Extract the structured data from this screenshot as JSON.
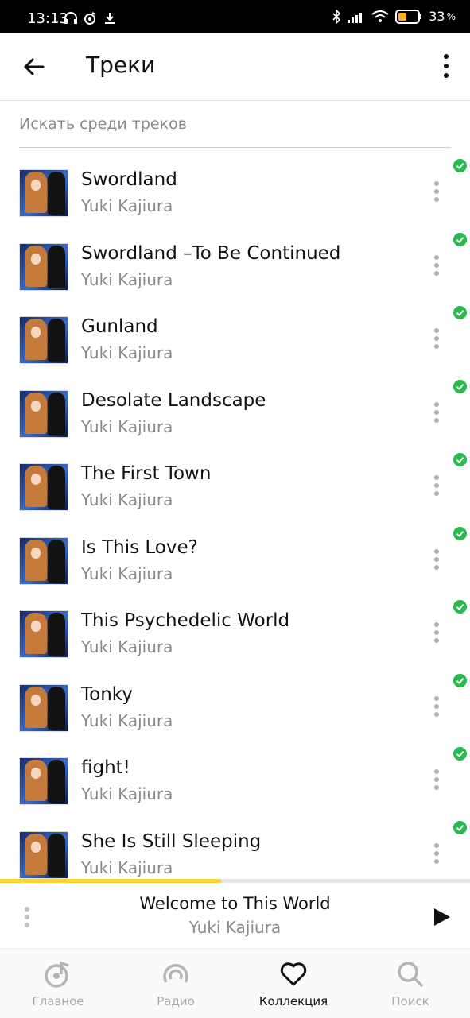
{
  "status": {
    "time": "13:13",
    "battery": "33"
  },
  "header": {
    "title": "Треки"
  },
  "search": {
    "placeholder": "Искать среди треков"
  },
  "tracks": [
    {
      "title": "Swordland",
      "artist": "Yuki Kajiura"
    },
    {
      "title": "Swordland –To Be Continued",
      "artist": "Yuki Kajiura"
    },
    {
      "title": "Gunland",
      "artist": "Yuki Kajiura"
    },
    {
      "title": "Desolate Landscape",
      "artist": "Yuki Kajiura"
    },
    {
      "title": "The First Town",
      "artist": "Yuki Kajiura"
    },
    {
      "title": "Is This Love?",
      "artist": "Yuki Kajiura"
    },
    {
      "title": "This Psychedelic World",
      "artist": "Yuki Kajiura"
    },
    {
      "title": "Tonky",
      "artist": "Yuki Kajiura"
    },
    {
      "title": "fight!",
      "artist": "Yuki Kajiura"
    },
    {
      "title": "She Is Still Sleeping",
      "artist": "Yuki Kajiura"
    }
  ],
  "player": {
    "title": "Welcome to This World",
    "artist": "Yuki Kajiura",
    "progress": 0.47
  },
  "nav": [
    {
      "label": "Главное",
      "icon": "note-disc-icon"
    },
    {
      "label": "Радио",
      "icon": "radio-icon"
    },
    {
      "label": "Коллекция",
      "icon": "heart-icon"
    },
    {
      "label": "Поиск",
      "icon": "search-icon"
    }
  ],
  "colors": {
    "accent": "#ffd333",
    "check": "#2bb94f"
  }
}
